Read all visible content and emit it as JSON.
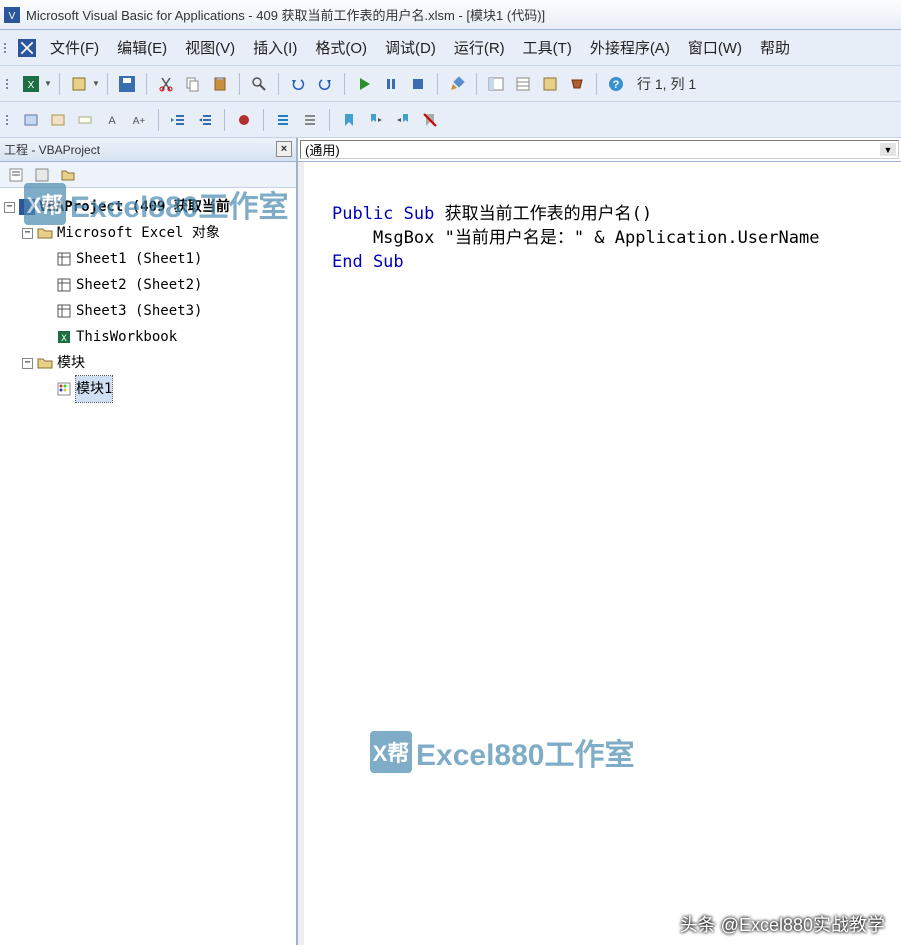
{
  "title": "Microsoft Visual Basic for Applications - 409 获取当前工作表的用户名.xlsm - [模块1 (代码)]",
  "menu": {
    "file": "文件(F)",
    "edit": "编辑(E)",
    "view": "视图(V)",
    "insert": "插入(I)",
    "format": "格式(O)",
    "debug": "调试(D)",
    "run": "运行(R)",
    "tools": "工具(T)",
    "addins": "外接程序(A)",
    "window": "窗口(W)",
    "help": "帮助"
  },
  "status_position": "行 1, 列 1",
  "project_panel": {
    "title": "工程 - VBAProject",
    "root": "VBAProject (409 获取当前",
    "excel_objects": "Microsoft Excel 对象",
    "sheet1": "Sheet1 (Sheet1)",
    "sheet2": "Sheet2 (Sheet2)",
    "sheet3": "Sheet3 (Sheet3)",
    "thisworkbook": "ThisWorkbook",
    "modules": "模块",
    "module1": "模块1"
  },
  "code_dropdowns": {
    "object": "(通用)",
    "procedure": ""
  },
  "code": {
    "line1_kw1": "Public Sub",
    "line1_name": " 获取当前工作表的用户名()",
    "line2_indent": "    MsgBox \"当前用户名是：\" & Application.UserName",
    "line3_kw": "End Sub"
  },
  "watermark": "Excel880工作室",
  "footer": "头条 @Excel880实战教学"
}
